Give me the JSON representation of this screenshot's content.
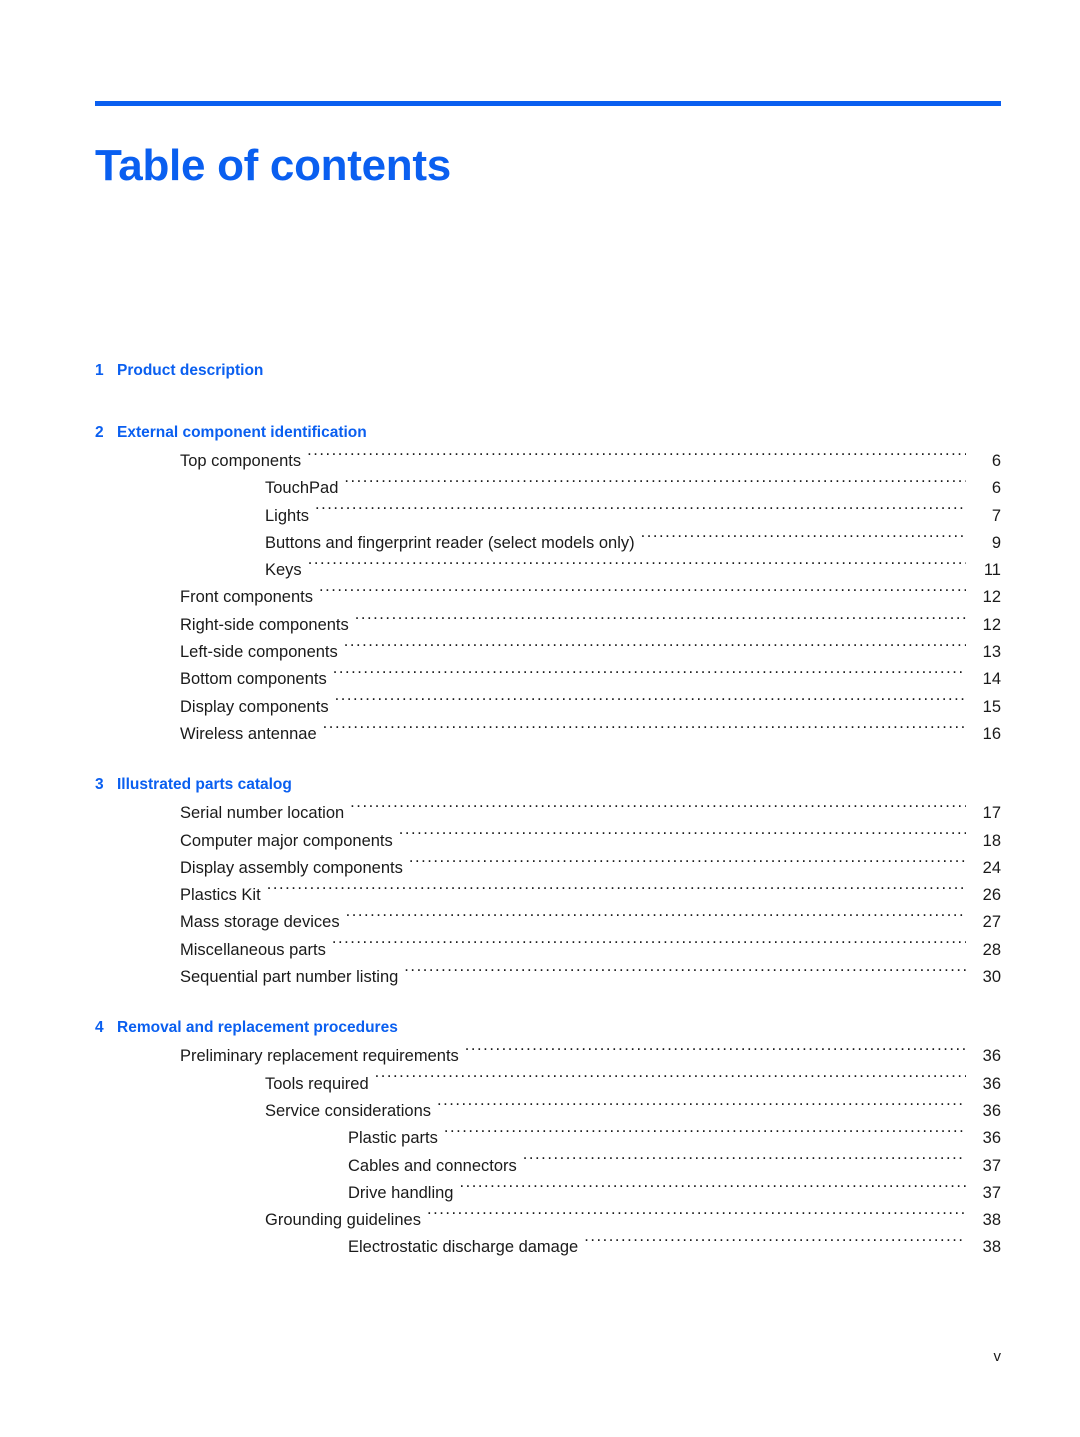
{
  "document": {
    "title": "Table of contents",
    "accent_color": "#0a5ff0",
    "page_label": "v"
  },
  "toc": {
    "chapters": [
      {
        "number": "1",
        "title": "Product description",
        "entries": []
      },
      {
        "number": "2",
        "title": "External component identification",
        "entries": [
          {
            "level": 1,
            "label": "Top components",
            "page": "6"
          },
          {
            "level": 2,
            "label": "TouchPad",
            "page": "6"
          },
          {
            "level": 2,
            "label": "Lights",
            "page": "7"
          },
          {
            "level": 2,
            "label": "Buttons and fingerprint reader (select models only)",
            "page": "9"
          },
          {
            "level": 2,
            "label": "Keys",
            "page": "11"
          },
          {
            "level": 1,
            "label": "Front components",
            "page": "12"
          },
          {
            "level": 1,
            "label": "Right-side components",
            "page": "12"
          },
          {
            "level": 1,
            "label": "Left-side components",
            "page": "13"
          },
          {
            "level": 1,
            "label": "Bottom components",
            "page": "14"
          },
          {
            "level": 1,
            "label": "Display components",
            "page": "15"
          },
          {
            "level": 1,
            "label": "Wireless antennae",
            "page": "16"
          }
        ]
      },
      {
        "number": "3",
        "title": "Illustrated parts catalog",
        "entries": [
          {
            "level": 1,
            "label": "Serial number location",
            "page": "17"
          },
          {
            "level": 1,
            "label": "Computer major components",
            "page": "18"
          },
          {
            "level": 1,
            "label": "Display assembly components",
            "page": "24"
          },
          {
            "level": 1,
            "label": "Plastics Kit",
            "page": "26"
          },
          {
            "level": 1,
            "label": "Mass storage devices",
            "page": "27"
          },
          {
            "level": 1,
            "label": "Miscellaneous parts",
            "page": "28"
          },
          {
            "level": 1,
            "label": "Sequential part number listing",
            "page": "30"
          }
        ]
      },
      {
        "number": "4",
        "title": "Removal and replacement procedures",
        "entries": [
          {
            "level": 1,
            "label": "Preliminary replacement requirements",
            "page": "36"
          },
          {
            "level": 2,
            "label": "Tools required",
            "page": "36"
          },
          {
            "level": 2,
            "label": "Service considerations",
            "page": "36"
          },
          {
            "level": 3,
            "label": "Plastic parts",
            "page": "36"
          },
          {
            "level": 3,
            "label": "Cables and connectors",
            "page": "37"
          },
          {
            "level": 3,
            "label": "Drive handling",
            "page": "37"
          },
          {
            "level": 2,
            "label": "Grounding guidelines",
            "page": "38"
          },
          {
            "level": 3,
            "label": "Electrostatic discharge damage",
            "page": "38"
          }
        ]
      }
    ]
  }
}
